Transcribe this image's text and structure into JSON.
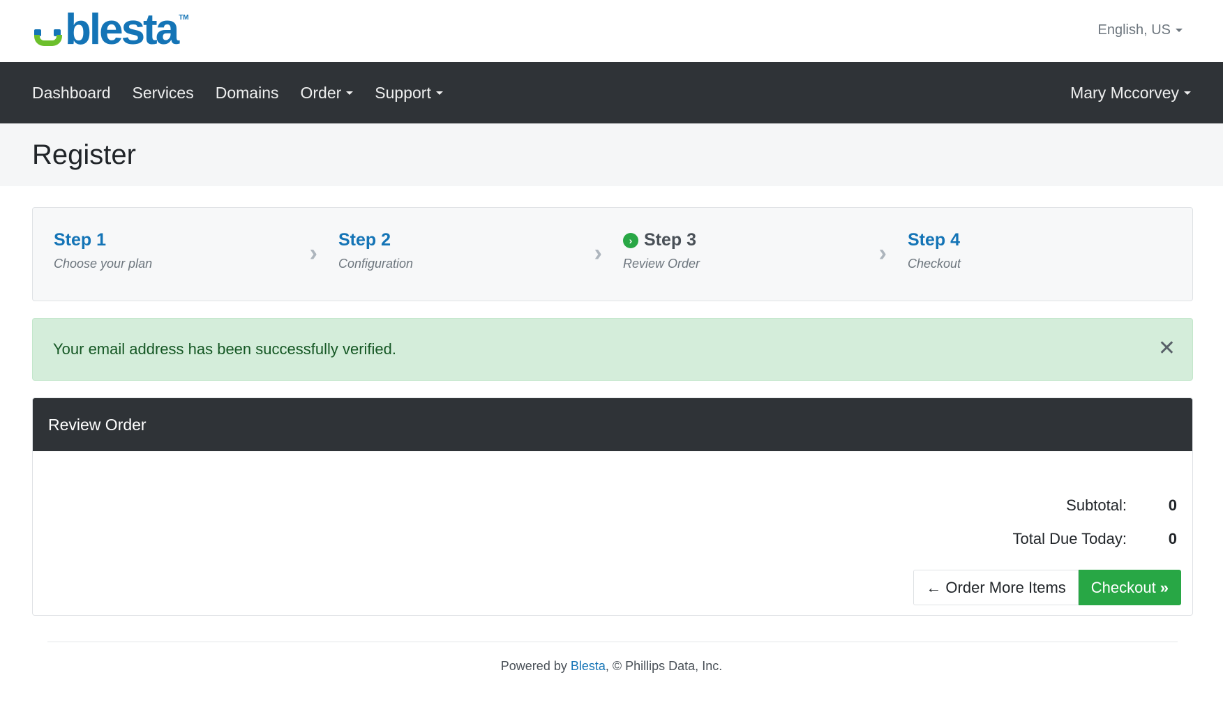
{
  "header": {
    "logo_text": "blesta",
    "logo_tm": "TM",
    "language": "English, US"
  },
  "nav": {
    "items": [
      "Dashboard",
      "Services",
      "Domains",
      "Order",
      "Support"
    ],
    "user": "Mary Mccorvey"
  },
  "page": {
    "title": "Register"
  },
  "steps": [
    {
      "title": "Step 1",
      "subtitle": "Choose your plan"
    },
    {
      "title": "Step 2",
      "subtitle": "Configuration"
    },
    {
      "title": "Step 3",
      "subtitle": "Review Order"
    },
    {
      "title": "Step 4",
      "subtitle": "Checkout"
    }
  ],
  "alert": {
    "message": "Your email address has been successfully verified."
  },
  "review": {
    "title": "Review Order",
    "subtotal_label": "Subtotal:",
    "subtotal_value": "0",
    "total_label": "Total Due Today:",
    "total_value": "0",
    "order_more_label": "Order More Items",
    "checkout_label": "Checkout"
  },
  "footer": {
    "prefix": "Powered by ",
    "link": "Blesta",
    "suffix": ", © Phillips Data, Inc."
  },
  "colors": {
    "brand_blue": "#1474b6",
    "brand_green": "#6cbf2c",
    "nav_bg": "#2f3337",
    "success": "#28a745",
    "alert_bg": "#d4edda"
  }
}
